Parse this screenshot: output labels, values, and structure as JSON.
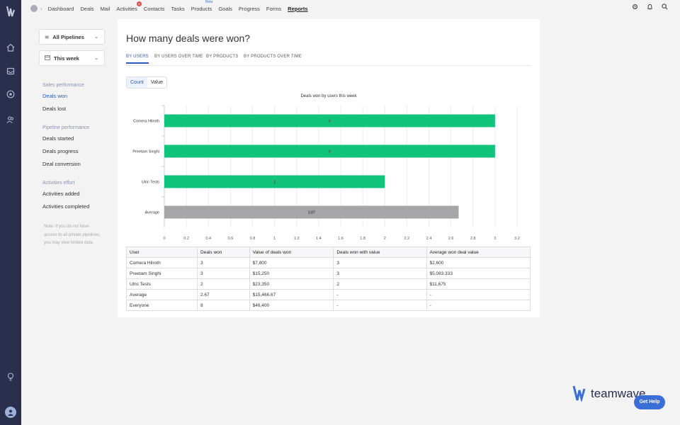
{
  "nav": {
    "items": [
      {
        "label": "Dashboard"
      },
      {
        "label": "Deals"
      },
      {
        "label": "Mail"
      },
      {
        "label": "Activities",
        "badge": "4"
      },
      {
        "label": "Contacts"
      },
      {
        "label": "Tasks"
      },
      {
        "label": "Products",
        "tag": "Beta"
      },
      {
        "label": "Goals"
      },
      {
        "label": "Progress"
      },
      {
        "label": "Forms"
      },
      {
        "label": "Reports",
        "active": true
      }
    ]
  },
  "sidebar": {
    "pipeline": "All Pipelines",
    "period": "This week",
    "sections": [
      {
        "heading": "Sales performance",
        "items": [
          "Deals won",
          "Deals lost"
        ]
      },
      {
        "heading": "Pipeline performance",
        "items": [
          "Deals started",
          "Deals progress",
          "Deal conversion"
        ]
      },
      {
        "heading": "Activities effort",
        "items": [
          "Activities added",
          "Activities completed"
        ]
      }
    ],
    "note": "Note: If you do not have access to all private pipelines, you may view limited data."
  },
  "page": {
    "title": "How many deals were won?",
    "tabs": [
      "BY USERS",
      "BY USERS OVER TIME",
      "BY PRODUCTS",
      "BY PRODUCTS OVER TIME"
    ],
    "toggle": [
      "Count",
      "Value"
    ]
  },
  "chart_data": {
    "type": "bar",
    "orientation": "horizontal",
    "title": "Deals won by users this week",
    "categories": [
      "Comera Hilroth",
      "Preetam Singhi",
      "Ulric Tests",
      "Average"
    ],
    "values": [
      3,
      3,
      2,
      2.67
    ],
    "value_labels": [
      "3",
      "3",
      "2",
      "2.67"
    ],
    "colors": [
      "#10c47c",
      "#10c47c",
      "#10c47c",
      "#a6a6a8"
    ],
    "xlim": [
      0,
      3.2
    ],
    "xticks": [
      "0",
      "0.2",
      "0.4",
      "0.6",
      "0.8",
      "1",
      "1.2",
      "1.4",
      "1.6",
      "1.8",
      "2",
      "2.2",
      "2.4",
      "2.6",
      "2.8",
      "3",
      "3.2"
    ],
    "grid": true
  },
  "table": {
    "headers": [
      "User",
      "Deals won",
      "Value of deals won",
      "Deals won with value",
      "Average won deal value"
    ],
    "rows": [
      [
        "Comera Hilroth",
        "3",
        "$7,800",
        "3",
        "$2,600"
      ],
      [
        "Preetam Singhi",
        "3",
        "$15,250",
        "3",
        "$5,083.333"
      ],
      [
        "Ulric Tests",
        "2",
        "$23,350",
        "2",
        "$11,675"
      ],
      [
        "Average",
        "2.67",
        "$15,466.67",
        "-",
        "-"
      ],
      [
        "Everyone",
        "8",
        "$46,400",
        "-",
        "-"
      ]
    ]
  },
  "brand": {
    "name": "teamwave"
  },
  "help": {
    "label": "Get Help"
  }
}
